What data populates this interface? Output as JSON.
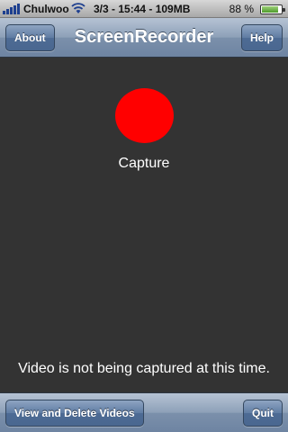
{
  "status_bar": {
    "carrier": "Chulwoo",
    "center_text": "3/3 - 15:44 - 109MB",
    "battery_percent": "88 %",
    "battery_level": 0.88,
    "signal_icon": "signal-bars-icon",
    "wifi_icon": "wifi-icon",
    "battery_icon": "battery-icon"
  },
  "nav_bar": {
    "title": "ScreenRecorder",
    "left_button": "About",
    "right_button": "Help"
  },
  "main": {
    "record_button_color": "#ff0000",
    "capture_label": "Capture",
    "status_message": "Video is not being captured at this time."
  },
  "toolbar": {
    "left_button": "View and Delete Videos",
    "right_button": "Quit"
  },
  "colors": {
    "background": "#333333",
    "bar_accent": "#6e84a2",
    "record": "#ff0000"
  }
}
